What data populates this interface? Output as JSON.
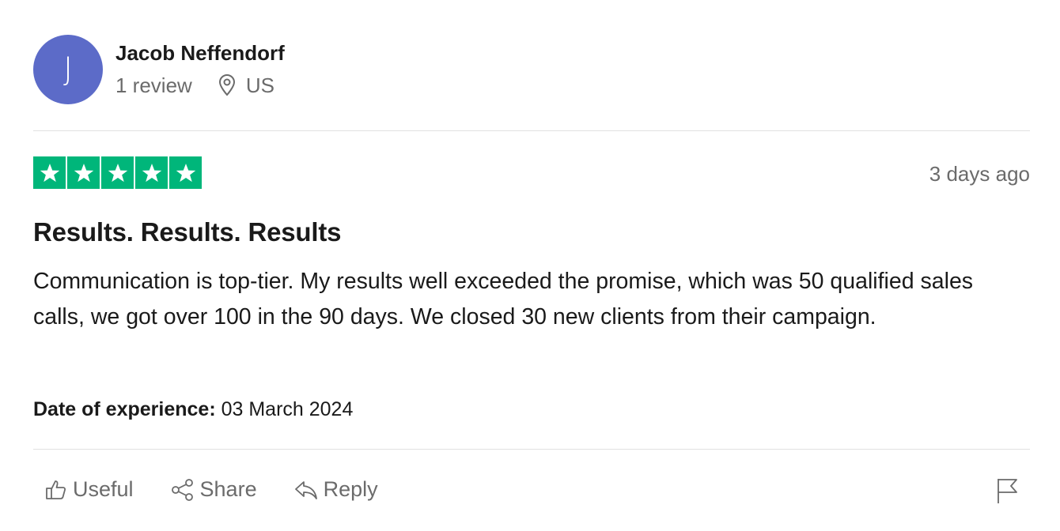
{
  "author": {
    "initial": "J",
    "name": "Jacob Neffendorf",
    "review_count": "1 review",
    "country": "US",
    "avatar_color": "#5c6bc8"
  },
  "review": {
    "rating": 5,
    "star_color": "#00b67a",
    "posted": "3 days ago",
    "title": "Results. Results. Results",
    "body": "Communication is top-tier. My results well exceeded the promise, which was 50 qualified sales calls, we got over 100 in the 90 days. We closed 30 new clients from their campaign.",
    "experience_label": "Date of experience:",
    "experience_date": "03 March 2024"
  },
  "actions": {
    "useful": "Useful",
    "share": "Share",
    "reply": "Reply",
    "useful_icon": "thumbs-up-icon",
    "share_icon": "share-icon",
    "reply_icon": "reply-icon",
    "flag_icon": "flag-icon"
  }
}
